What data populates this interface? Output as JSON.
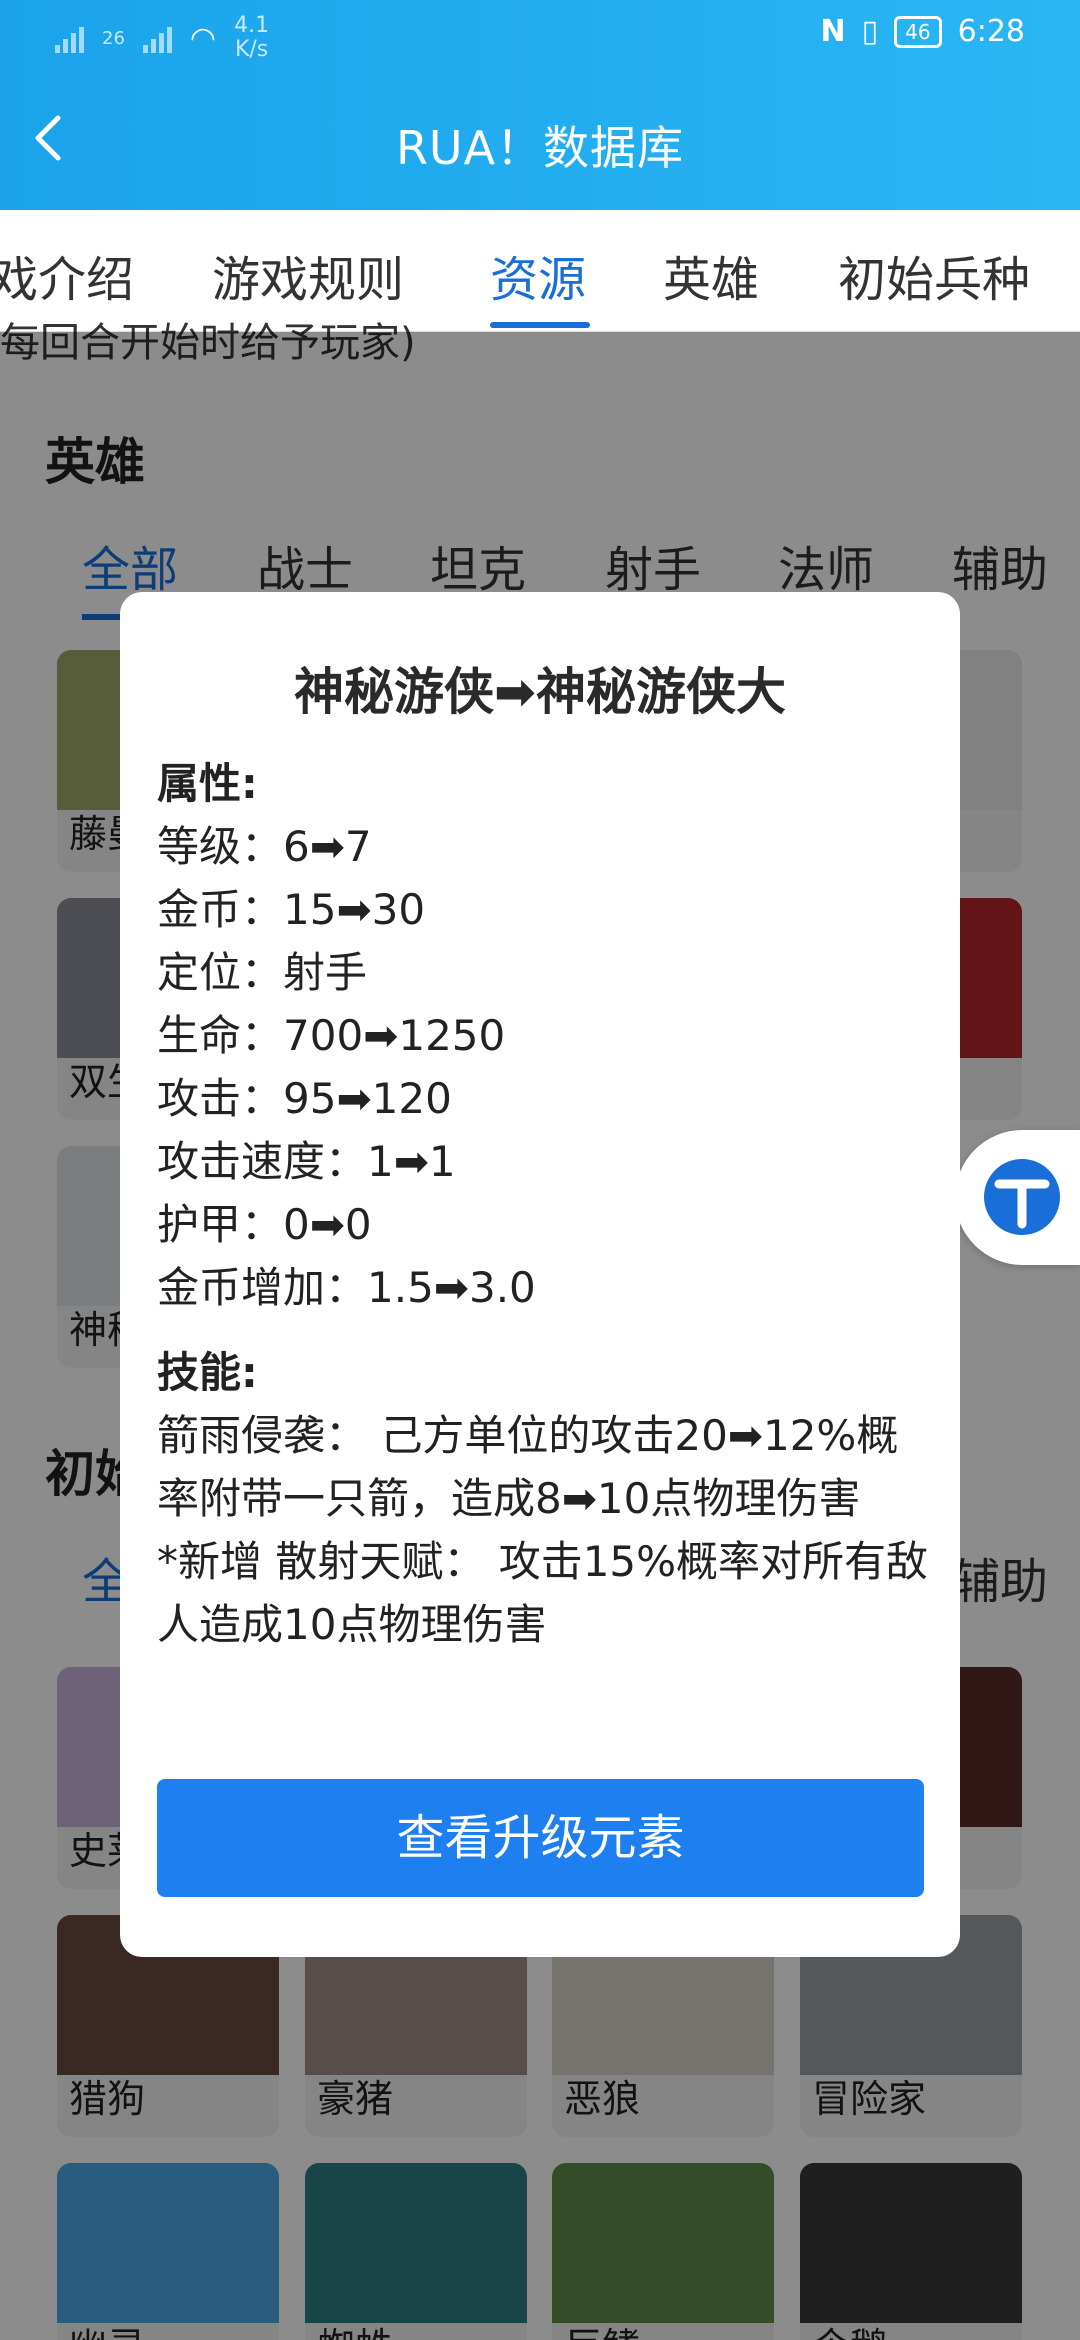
{
  "status": {
    "signal_a": "26",
    "net_speed": "4.1",
    "net_unit": "K/s",
    "battery": "46",
    "time": "6:28"
  },
  "header": {
    "title": "RUA！数据库"
  },
  "tabs": [
    {
      "label": "戏介绍"
    },
    {
      "label": "游戏规则"
    },
    {
      "label": "资源"
    },
    {
      "label": "英雄"
    },
    {
      "label": "初始兵种"
    }
  ],
  "cut_text": "每回合开始时给予玩家)",
  "section_heroes": {
    "title": "英雄",
    "filters": [
      "全部",
      "战士",
      "坦克",
      "射手",
      "法师",
      "辅助"
    ],
    "cards": [
      "藤曼",
      "双生",
      "神秘"
    ]
  },
  "section_units": {
    "title": "初始",
    "filter_first": "全",
    "filter_last": "辅助",
    "cards": [
      "史莱",
      "猎狗",
      "豪猪",
      "恶狼",
      "冒险家",
      "幽灵",
      "蜘蛛",
      "巨鳍",
      "企鹅"
    ]
  },
  "dialog": {
    "title": "神秘游侠➡神秘游侠大",
    "attr_head": "属性:",
    "attrs": [
      "等级：6➡7",
      "金币：15➡30",
      "定位：射手",
      "生命：700➡1250",
      "攻击：95➡120",
      "攻击速度：1➡1",
      "护甲：0➡0",
      "金币增加：1.5➡3.0"
    ],
    "skill_head": "技能:",
    "skill_1": "箭雨侵袭： 己方单位的攻击20➡12%概率附带一只箭，造成8➡10点物理伤害",
    "skill_2": "*新增 散射天赋： 攻击15%概率对所有敌人造成10点物理伤害",
    "button": "查看升级元素"
  },
  "colors": {
    "appbar": "#1aa3ea",
    "accent": "#1a6ed8",
    "button": "#1e7ff0"
  }
}
